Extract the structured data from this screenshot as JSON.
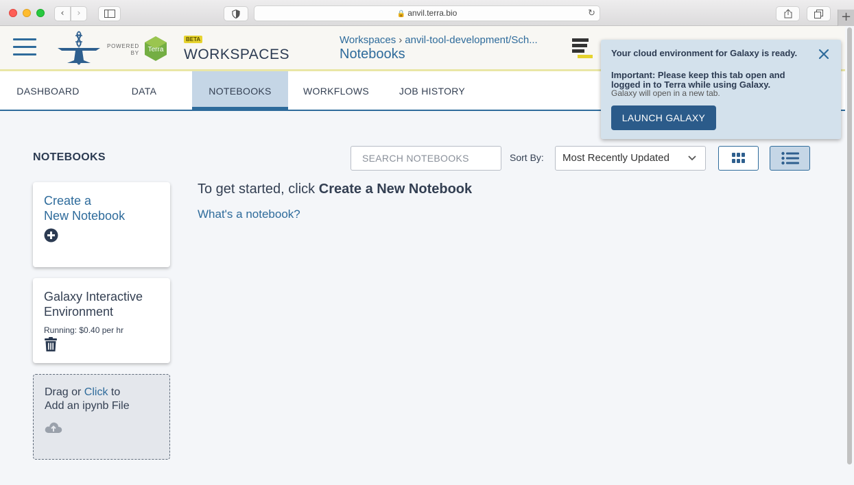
{
  "browser": {
    "url": "anvil.terra.bio"
  },
  "header": {
    "powered_line1": "POWERED",
    "powered_line2": "BY",
    "terra_label": "Terra",
    "beta": "BETA",
    "title": "WORKSPACES",
    "breadcrumb_root": "Workspaces",
    "breadcrumb_sep": "›",
    "breadcrumb_workspace": "anvil-tool-development/Sch...",
    "page_title": "Notebooks"
  },
  "tabs": [
    {
      "label": "DASHBOARD"
    },
    {
      "label": "DATA"
    },
    {
      "label": "NOTEBOOKS",
      "active": true
    },
    {
      "label": "WORKFLOWS"
    },
    {
      "label": "JOB HISTORY"
    }
  ],
  "main": {
    "section_title": "NOTEBOOKS",
    "search_placeholder": "SEARCH NOTEBOOKS",
    "sort_label": "Sort By:",
    "sort_value": "Most Recently Updated",
    "start_prefix": "To get started, click ",
    "start_bold": "Create a New Notebook",
    "whats_link": "What's a notebook?"
  },
  "cards": {
    "create_line1": "Create a",
    "create_line2": "New Notebook",
    "galaxy_line1": "Galaxy Interactive",
    "galaxy_line2": "Environment",
    "galaxy_status": "Running: $0.40 per hr",
    "drop_prefix": "Drag or ",
    "drop_link": "Click",
    "drop_suffix": " to",
    "drop_line2": "Add an ipynb File"
  },
  "toast": {
    "message": "Your cloud environment for Galaxy is ready.",
    "important": "Important: Please keep this tab open and logged in to Terra while using Galaxy.",
    "sub": "Galaxy will open in a new tab.",
    "launch_label": "LAUNCH GALAXY"
  },
  "colors": {
    "primary": "#2e6b9b",
    "active_tab_bg": "#c5d6e6",
    "toast_bg": "#d3e1ec",
    "launch_button": "#2b5b8a",
    "terra_green": "#74ae43"
  }
}
